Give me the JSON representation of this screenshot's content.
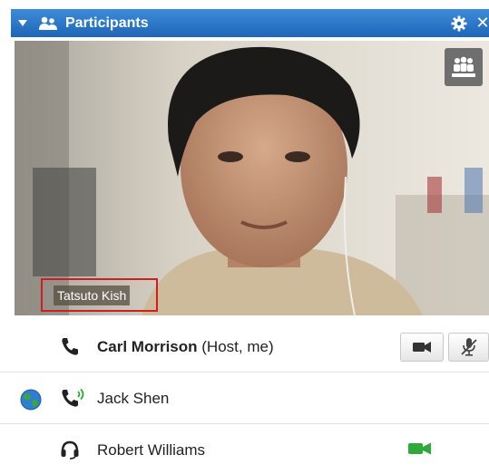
{
  "panel": {
    "title": "Participants",
    "accent_color": "#2c76c9"
  },
  "video": {
    "active_speaker_name": "Tatsuto Kish",
    "highlight_color": "#cc1f1f"
  },
  "participants": [
    {
      "name": "Carl Morrison",
      "role": "(Host, me)",
      "connection": "phone",
      "controls": [
        "video-camera-icon",
        "mute-microphone-icon"
      ]
    },
    {
      "name": "Jack Shen",
      "role": "",
      "connection": "phone-speaking",
      "status": "globe-icon"
    },
    {
      "name": "Robert Williams",
      "role": "",
      "connection": "headset",
      "video_status": "green-video-camera-icon"
    }
  ]
}
